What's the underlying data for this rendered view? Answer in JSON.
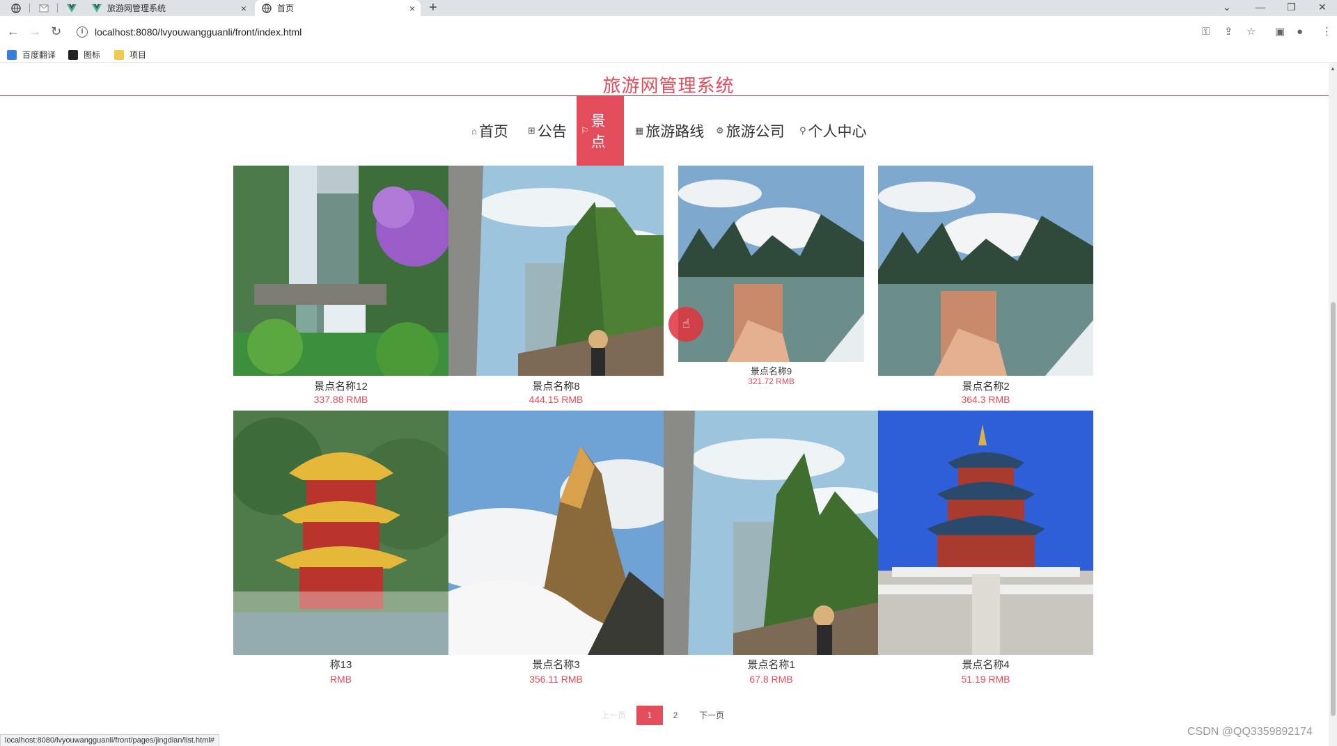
{
  "browser": {
    "tabs": [
      {
        "title": "旅游网管理系统",
        "close": "×",
        "active": false
      },
      {
        "title": "首页",
        "close": "×",
        "active": true
      }
    ],
    "new_tab": "+",
    "url": "localhost:8080/lvyouwangguanli/front/index.html",
    "bookmarks": [
      {
        "label": "百度翻译",
        "color": "#3b7ddd"
      },
      {
        "label": "图标",
        "color": "#222222"
      },
      {
        "label": "项目",
        "color": "#f2c94c"
      }
    ],
    "status_url": "localhost:8080/lvyouwangguanli/front/pages/jingdian/list.html#"
  },
  "site": {
    "title": "旅游网管理系统",
    "accent": "#e34c5a",
    "nav": [
      {
        "label": "首页",
        "icon": "home-icon",
        "active": false
      },
      {
        "label": "公告",
        "icon": "notice-icon",
        "active": false
      },
      {
        "label": "景点",
        "icon": "flag-icon",
        "active": true
      },
      {
        "label": "旅游路线",
        "icon": "grid-icon",
        "active": false
      },
      {
        "label": "旅游公司",
        "icon": "gear-icon",
        "active": false
      },
      {
        "label": "个人中心",
        "icon": "user-icon",
        "active": false
      }
    ]
  },
  "spots": [
    {
      "name": "景点名称12",
      "price": "337.88 RMB",
      "scene": "waterfall"
    },
    {
      "name": "景点名称8",
      "price": "444.15 RMB",
      "scene": "cliff"
    },
    {
      "name": "景点名称9",
      "price": "321.72 RMB",
      "scene": "river"
    },
    {
      "name": "景点名称2",
      "price": "364.3 RMB",
      "scene": "river"
    },
    {
      "name": "称13",
      "price": "RMB",
      "scene": "pagoda"
    },
    {
      "name": "景点名称3",
      "price": "356.11 RMB",
      "scene": "peak"
    },
    {
      "name": "景点名称1",
      "price": "67.8 RMB",
      "scene": "cliff"
    },
    {
      "name": "景点名称4",
      "price": "51.19 RMB",
      "scene": "temple"
    }
  ],
  "pagination": {
    "prev": "上一页",
    "pages": [
      "1",
      "2"
    ],
    "current": "1",
    "next": "下一页"
  },
  "watermark": "CSDN @QQ3359892174"
}
